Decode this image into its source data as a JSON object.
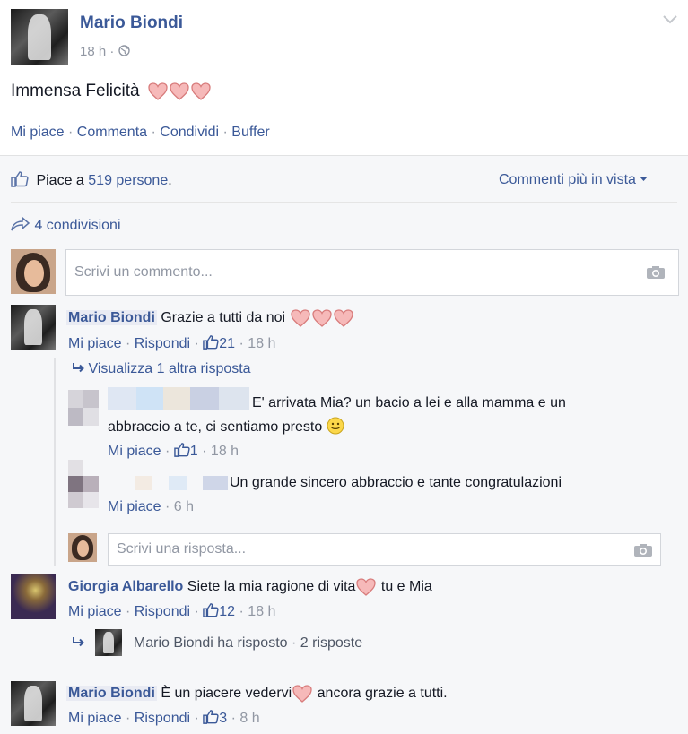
{
  "post": {
    "author": "Mario Biondi",
    "time": "18 h",
    "text": "Immensa Felicità",
    "actions": {
      "like": "Mi piace",
      "comment": "Commenta",
      "share": "Condividi",
      "buffer": "Buffer"
    }
  },
  "likes": {
    "prefix": "Piace a ",
    "count_text": "519 persone",
    "suffix": ".",
    "sort_label": "Commenti più in vista"
  },
  "shares": {
    "label": "4 condivisioni"
  },
  "comment_box": {
    "placeholder": "Scrivi un commento..."
  },
  "comments": [
    {
      "author": "Mario Biondi",
      "text": "Grazie a tutti da noi",
      "like": "Mi piace",
      "reply": "Rispondi",
      "likes": "21",
      "time": "18 h",
      "view_more": "Visualizza 1 altra risposta",
      "replies": [
        {
          "text_line1": "E' arrivata Mia? un bacio a lei e alla mamma e un",
          "text_line2": "abbraccio a te, ci sentiamo presto",
          "like": "Mi piace",
          "likes": "1",
          "time": "18 h"
        },
        {
          "text": "Un grande sincero abbraccio e tante congratulazioni",
          "like": "Mi piace",
          "time": "6 h"
        }
      ],
      "reply_placeholder": "Scrivi una risposta..."
    },
    {
      "author": "Giorgia Albarello",
      "text": "Siete la mia ragione di vita",
      "text_after": "tu e Mia",
      "like": "Mi piace",
      "reply": "Rispondi",
      "likes": "12",
      "time": "18 h",
      "replied_by": "Mario Biondi ha risposto",
      "replies_count": "2 risposte"
    },
    {
      "author": "Mario Biondi",
      "text": "È un piacere vedervi",
      "text_after": "ancora grazie a tutti.",
      "like": "Mi piace",
      "reply": "Rispondi",
      "likes": "3",
      "time": "8 h"
    }
  ]
}
